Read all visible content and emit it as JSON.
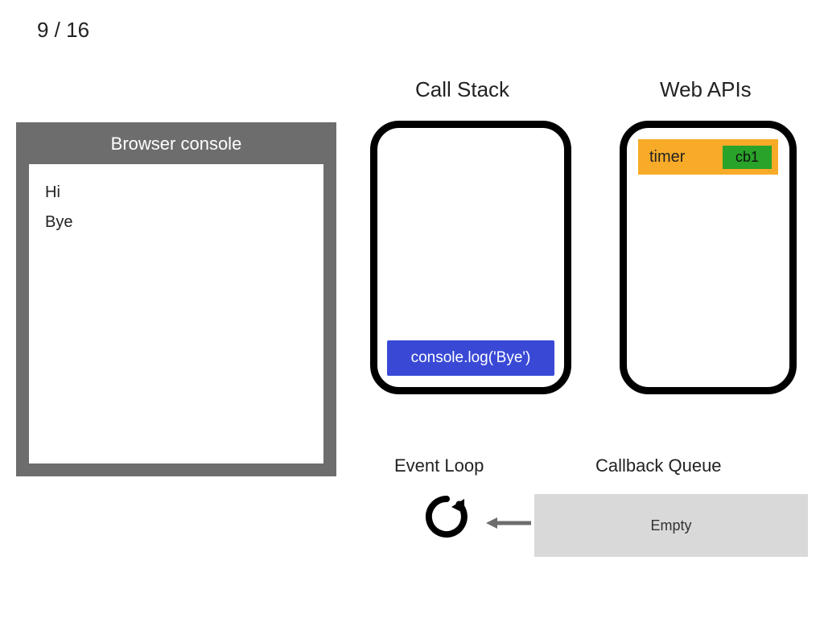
{
  "page": {
    "current": 9,
    "total": 16,
    "display": "9 / 16"
  },
  "console": {
    "title": "Browser console",
    "lines": [
      "Hi",
      "Bye"
    ]
  },
  "headings": {
    "callstack": "Call Stack",
    "webapis": "Web APIs",
    "eventloop": "Event Loop",
    "cbqueue": "Callback Queue"
  },
  "callstack": {
    "frames": [
      "console.log('Bye')"
    ]
  },
  "webapis": {
    "timer": {
      "label": "timer",
      "callback": "cb1"
    }
  },
  "callback_queue": {
    "state": "Empty",
    "items": []
  },
  "colors": {
    "console_frame": "#6d6d6d",
    "stack_frame_bg": "#3949d6",
    "timer_bg": "#f8ab29",
    "timer_cb_bg": "#29a329",
    "queue_bg": "#d9d9d9",
    "panel_border": "#000000"
  }
}
